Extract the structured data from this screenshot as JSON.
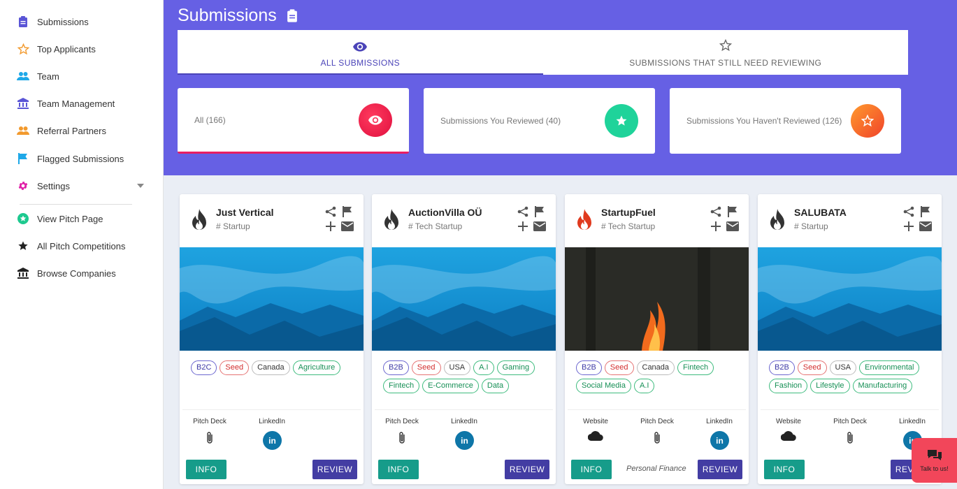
{
  "sidebar": {
    "items": [
      {
        "label": "Submissions",
        "icon": "clipboard-icon"
      },
      {
        "label": "Top Applicants",
        "icon": "star-outline-icon"
      },
      {
        "label": "Team",
        "icon": "people-icon"
      },
      {
        "label": "Team Management",
        "icon": "bank-icon"
      },
      {
        "label": "Referral Partners",
        "icon": "people-icon"
      },
      {
        "label": "Flagged Submissions",
        "icon": "flag-icon"
      },
      {
        "label": "Settings",
        "icon": "gear-icon"
      },
      {
        "label": "View Pitch Page",
        "icon": "star-circle-icon"
      },
      {
        "label": "All Pitch Competitions",
        "icon": "star-icon"
      },
      {
        "label": "Browse Companies",
        "icon": "bank-icon"
      }
    ]
  },
  "header": {
    "title": "Submissions"
  },
  "tabs": [
    {
      "label": "ALL SUBMISSIONS",
      "active": true
    },
    {
      "label": "SUBMISSIONS THAT STILL NEED REVIEWING",
      "active": false
    }
  ],
  "stats": [
    {
      "label": "All (166)",
      "color": "#ec1c4d"
    },
    {
      "label": "Submissions You Reviewed (40)",
      "color": "#1fd39a"
    },
    {
      "label": "Submissions You Haven't Reviewed (126)",
      "color": "#f5682a"
    }
  ],
  "cards": [
    {
      "name": "Just Vertical",
      "type": "# Startup",
      "banner": "sky",
      "tags": [
        [
          "B2C",
          "blue"
        ],
        [
          "Seed",
          "red"
        ],
        [
          "Canada",
          "gray"
        ],
        [
          "Agriculture",
          "green"
        ]
      ],
      "links": [
        "Pitch Deck",
        "LinkedIn"
      ],
      "extra": "",
      "info": "INFO",
      "review": "REVIEW"
    },
    {
      "name": "AuctionVilla OÜ",
      "type": "# Tech Startup",
      "banner": "sky",
      "tags": [
        [
          "B2B",
          "blue"
        ],
        [
          "Seed",
          "red"
        ],
        [
          "USA",
          "gray"
        ],
        [
          "A.I",
          "green"
        ],
        [
          "Gaming",
          "green"
        ],
        [
          "Fintech",
          "green"
        ],
        [
          "E-Commerce",
          "green"
        ],
        [
          "Data",
          "green"
        ]
      ],
      "links": [
        "Pitch Deck",
        "LinkedIn"
      ],
      "extra": "",
      "info": "INFO",
      "review": "REVIEW"
    },
    {
      "name": "StartupFuel",
      "type": "# Tech Startup",
      "banner": "fire",
      "tags": [
        [
          "B2B",
          "blue"
        ],
        [
          "Seed",
          "red"
        ],
        [
          "Canada",
          "gray"
        ],
        [
          "Fintech",
          "green"
        ],
        [
          "Social Media",
          "green"
        ],
        [
          "A.I",
          "green"
        ]
      ],
      "links": [
        "Website",
        "Pitch Deck",
        "LinkedIn"
      ],
      "extra": "Personal Finance",
      "info": "INFO",
      "review": "REVIEW"
    },
    {
      "name": "SALUBATA",
      "type": "# Startup",
      "banner": "sky",
      "tags": [
        [
          "B2B",
          "blue"
        ],
        [
          "Seed",
          "red"
        ],
        [
          "USA",
          "gray"
        ],
        [
          "Environmental",
          "green"
        ],
        [
          "Fashion",
          "green"
        ],
        [
          "Lifestyle",
          "green"
        ],
        [
          "Manufacturing",
          "green"
        ]
      ],
      "links": [
        "Website",
        "Pitch Deck",
        "LinkedIn"
      ],
      "extra": "",
      "info": "INFO",
      "review": "REVIEW"
    }
  ],
  "chat": {
    "label": "Talk to us!"
  }
}
